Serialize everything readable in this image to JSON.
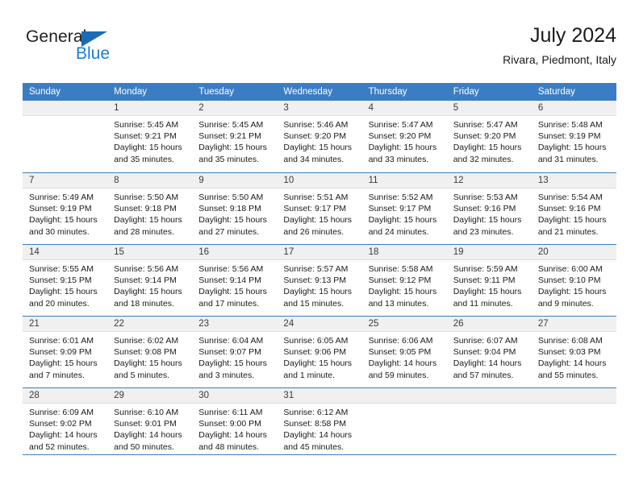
{
  "brand": {
    "word1": "General",
    "word2": "Blue",
    "triangle_color": "#1c6cb5",
    "blue_color": "#1a7fd4"
  },
  "header": {
    "title": "July 2024",
    "subtitle": "Rivara, Piedmont, Italy"
  },
  "theme": {
    "header_bar": "#3b7dc4",
    "day_band": "#f0f0f0",
    "text": "#1a1a1a"
  },
  "weekdays": [
    "Sunday",
    "Monday",
    "Tuesday",
    "Wednesday",
    "Thursday",
    "Friday",
    "Saturday"
  ],
  "weeks": [
    [
      {
        "day": "",
        "empty": true
      },
      {
        "day": "1",
        "sunrise": "Sunrise: 5:45 AM",
        "sunset": "Sunset: 9:21 PM",
        "daylight1": "Daylight: 15 hours",
        "daylight2": "and 35 minutes."
      },
      {
        "day": "2",
        "sunrise": "Sunrise: 5:45 AM",
        "sunset": "Sunset: 9:21 PM",
        "daylight1": "Daylight: 15 hours",
        "daylight2": "and 35 minutes."
      },
      {
        "day": "3",
        "sunrise": "Sunrise: 5:46 AM",
        "sunset": "Sunset: 9:20 PM",
        "daylight1": "Daylight: 15 hours",
        "daylight2": "and 34 minutes."
      },
      {
        "day": "4",
        "sunrise": "Sunrise: 5:47 AM",
        "sunset": "Sunset: 9:20 PM",
        "daylight1": "Daylight: 15 hours",
        "daylight2": "and 33 minutes."
      },
      {
        "day": "5",
        "sunrise": "Sunrise: 5:47 AM",
        "sunset": "Sunset: 9:20 PM",
        "daylight1": "Daylight: 15 hours",
        "daylight2": "and 32 minutes."
      },
      {
        "day": "6",
        "sunrise": "Sunrise: 5:48 AM",
        "sunset": "Sunset: 9:19 PM",
        "daylight1": "Daylight: 15 hours",
        "daylight2": "and 31 minutes."
      }
    ],
    [
      {
        "day": "7",
        "sunrise": "Sunrise: 5:49 AM",
        "sunset": "Sunset: 9:19 PM",
        "daylight1": "Daylight: 15 hours",
        "daylight2": "and 30 minutes."
      },
      {
        "day": "8",
        "sunrise": "Sunrise: 5:50 AM",
        "sunset": "Sunset: 9:18 PM",
        "daylight1": "Daylight: 15 hours",
        "daylight2": "and 28 minutes."
      },
      {
        "day": "9",
        "sunrise": "Sunrise: 5:50 AM",
        "sunset": "Sunset: 9:18 PM",
        "daylight1": "Daylight: 15 hours",
        "daylight2": "and 27 minutes."
      },
      {
        "day": "10",
        "sunrise": "Sunrise: 5:51 AM",
        "sunset": "Sunset: 9:17 PM",
        "daylight1": "Daylight: 15 hours",
        "daylight2": "and 26 minutes."
      },
      {
        "day": "11",
        "sunrise": "Sunrise: 5:52 AM",
        "sunset": "Sunset: 9:17 PM",
        "daylight1": "Daylight: 15 hours",
        "daylight2": "and 24 minutes."
      },
      {
        "day": "12",
        "sunrise": "Sunrise: 5:53 AM",
        "sunset": "Sunset: 9:16 PM",
        "daylight1": "Daylight: 15 hours",
        "daylight2": "and 23 minutes."
      },
      {
        "day": "13",
        "sunrise": "Sunrise: 5:54 AM",
        "sunset": "Sunset: 9:16 PM",
        "daylight1": "Daylight: 15 hours",
        "daylight2": "and 21 minutes."
      }
    ],
    [
      {
        "day": "14",
        "sunrise": "Sunrise: 5:55 AM",
        "sunset": "Sunset: 9:15 PM",
        "daylight1": "Daylight: 15 hours",
        "daylight2": "and 20 minutes."
      },
      {
        "day": "15",
        "sunrise": "Sunrise: 5:56 AM",
        "sunset": "Sunset: 9:14 PM",
        "daylight1": "Daylight: 15 hours",
        "daylight2": "and 18 minutes."
      },
      {
        "day": "16",
        "sunrise": "Sunrise: 5:56 AM",
        "sunset": "Sunset: 9:14 PM",
        "daylight1": "Daylight: 15 hours",
        "daylight2": "and 17 minutes."
      },
      {
        "day": "17",
        "sunrise": "Sunrise: 5:57 AM",
        "sunset": "Sunset: 9:13 PM",
        "daylight1": "Daylight: 15 hours",
        "daylight2": "and 15 minutes."
      },
      {
        "day": "18",
        "sunrise": "Sunrise: 5:58 AM",
        "sunset": "Sunset: 9:12 PM",
        "daylight1": "Daylight: 15 hours",
        "daylight2": "and 13 minutes."
      },
      {
        "day": "19",
        "sunrise": "Sunrise: 5:59 AM",
        "sunset": "Sunset: 9:11 PM",
        "daylight1": "Daylight: 15 hours",
        "daylight2": "and 11 minutes."
      },
      {
        "day": "20",
        "sunrise": "Sunrise: 6:00 AM",
        "sunset": "Sunset: 9:10 PM",
        "daylight1": "Daylight: 15 hours",
        "daylight2": "and 9 minutes."
      }
    ],
    [
      {
        "day": "21",
        "sunrise": "Sunrise: 6:01 AM",
        "sunset": "Sunset: 9:09 PM",
        "daylight1": "Daylight: 15 hours",
        "daylight2": "and 7 minutes."
      },
      {
        "day": "22",
        "sunrise": "Sunrise: 6:02 AM",
        "sunset": "Sunset: 9:08 PM",
        "daylight1": "Daylight: 15 hours",
        "daylight2": "and 5 minutes."
      },
      {
        "day": "23",
        "sunrise": "Sunrise: 6:04 AM",
        "sunset": "Sunset: 9:07 PM",
        "daylight1": "Daylight: 15 hours",
        "daylight2": "and 3 minutes."
      },
      {
        "day": "24",
        "sunrise": "Sunrise: 6:05 AM",
        "sunset": "Sunset: 9:06 PM",
        "daylight1": "Daylight: 15 hours",
        "daylight2": "and 1 minute."
      },
      {
        "day": "25",
        "sunrise": "Sunrise: 6:06 AM",
        "sunset": "Sunset: 9:05 PM",
        "daylight1": "Daylight: 14 hours",
        "daylight2": "and 59 minutes."
      },
      {
        "day": "26",
        "sunrise": "Sunrise: 6:07 AM",
        "sunset": "Sunset: 9:04 PM",
        "daylight1": "Daylight: 14 hours",
        "daylight2": "and 57 minutes."
      },
      {
        "day": "27",
        "sunrise": "Sunrise: 6:08 AM",
        "sunset": "Sunset: 9:03 PM",
        "daylight1": "Daylight: 14 hours",
        "daylight2": "and 55 minutes."
      }
    ],
    [
      {
        "day": "28",
        "sunrise": "Sunrise: 6:09 AM",
        "sunset": "Sunset: 9:02 PM",
        "daylight1": "Daylight: 14 hours",
        "daylight2": "and 52 minutes."
      },
      {
        "day": "29",
        "sunrise": "Sunrise: 6:10 AM",
        "sunset": "Sunset: 9:01 PM",
        "daylight1": "Daylight: 14 hours",
        "daylight2": "and 50 minutes."
      },
      {
        "day": "30",
        "sunrise": "Sunrise: 6:11 AM",
        "sunset": "Sunset: 9:00 PM",
        "daylight1": "Daylight: 14 hours",
        "daylight2": "and 48 minutes."
      },
      {
        "day": "31",
        "sunrise": "Sunrise: 6:12 AM",
        "sunset": "Sunset: 8:58 PM",
        "daylight1": "Daylight: 14 hours",
        "daylight2": "and 45 minutes."
      },
      {
        "day": "",
        "empty": true
      },
      {
        "day": "",
        "empty": true
      },
      {
        "day": "",
        "empty": true
      }
    ]
  ]
}
